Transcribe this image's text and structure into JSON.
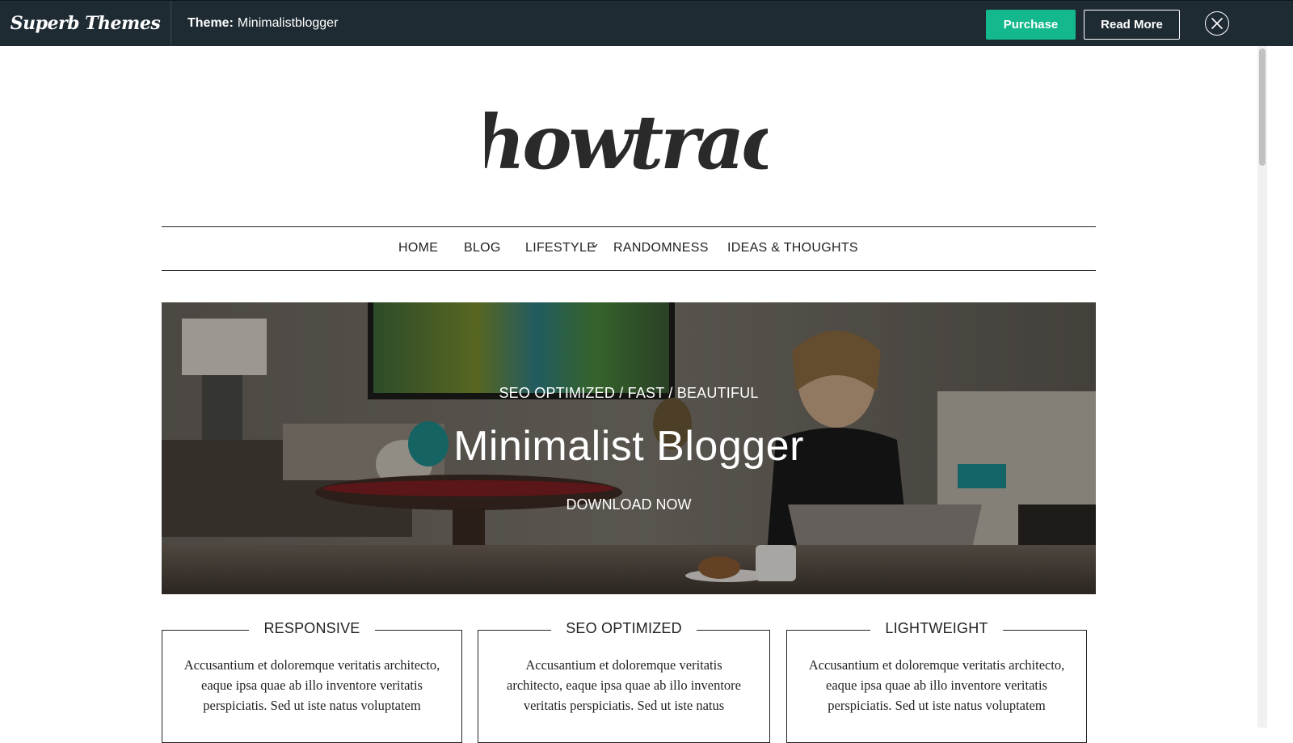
{
  "topbar": {
    "brand": "Superb Themes",
    "theme_label": "Theme:",
    "theme_name": "Minimalistblogger",
    "purchase_label": "Purchase",
    "readmore_label": "Read More",
    "accent_color": "#13b88d",
    "background_color": "#1f2b33"
  },
  "site": {
    "logo_text": "Showtrack"
  },
  "nav": {
    "items": [
      {
        "label": "HOME"
      },
      {
        "label": "BLOG"
      },
      {
        "label": "LIFESTYLE",
        "has_dropdown": true
      },
      {
        "label": "RANDOMNESS"
      },
      {
        "label": "IDEAS & THOUGHTS"
      }
    ]
  },
  "hero": {
    "subtitle": "SEO OPTIMIZED / FAST / BEAUTIFUL",
    "title": "Minimalist Blogger",
    "cta": "DOWNLOAD NOW"
  },
  "features": [
    {
      "title": "RESPONSIVE",
      "text": "Accusantium et doloremque veritatis architecto, eaque ipsa quae ab illo inventore veritatis perspiciatis. Sed ut iste natus voluptatem"
    },
    {
      "title": "SEO OPTIMIZED",
      "text": "Accusantium et doloremque veritatis architecto, eaque ipsa quae ab illo inventore veritatis perspiciatis. Sed ut iste natus"
    },
    {
      "title": "LIGHTWEIGHT",
      "text": "Accusantium et doloremque veritatis architecto, eaque ipsa quae ab illo inventore veritatis perspiciatis. Sed ut iste natus voluptatem"
    }
  ]
}
